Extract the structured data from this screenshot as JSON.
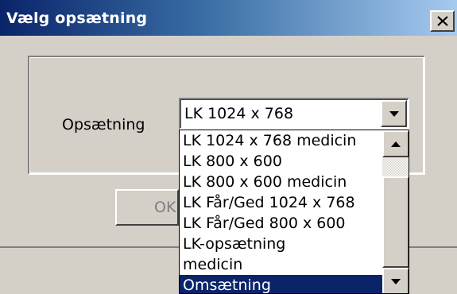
{
  "window": {
    "title": "Vælg opsætning",
    "close_icon": "close-icon"
  },
  "form": {
    "label": "Opsætning",
    "selected_value": "LK 1024 x 768",
    "ok_label": "OK"
  },
  "dropdown": {
    "items": [
      "LK 1024 x 768 medicin",
      "LK 800 x 600",
      "LK 800 x 600 medicin",
      "LK Får/Ged 1024 x 768",
      "LK Får/Ged 800 x 600",
      "LK-opsætning",
      "medicin",
      "Omsætning"
    ],
    "highlighted_index": 7
  },
  "colors": {
    "title_start": "#0a246a",
    "title_end": "#a6caf0",
    "face": "#d4d0c8",
    "highlight": "#0a246a"
  }
}
